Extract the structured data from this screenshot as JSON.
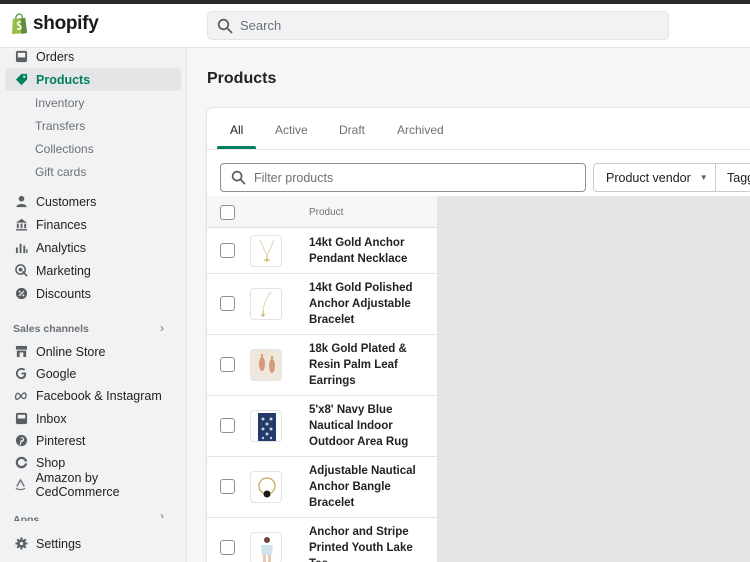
{
  "app": {
    "logo_text": "shopify"
  },
  "search": {
    "placeholder": "Search"
  },
  "sidebar": {
    "items": [
      {
        "label": "Orders",
        "icon": "inbox-icon"
      },
      {
        "label": "Products",
        "icon": "tag-icon",
        "active": true
      },
      {
        "label": "Customers",
        "icon": "person-icon"
      },
      {
        "label": "Finances",
        "icon": "bank-icon"
      },
      {
        "label": "Analytics",
        "icon": "bar-chart-icon"
      },
      {
        "label": "Marketing",
        "icon": "target-icon"
      },
      {
        "label": "Discounts",
        "icon": "discount-icon"
      }
    ],
    "product_subitems": [
      "Inventory",
      "Transfers",
      "Collections",
      "Gift cards"
    ],
    "sales_channels_label": "Sales channels",
    "channels": [
      {
        "label": "Online Store",
        "icon": "store-icon"
      },
      {
        "label": "Google",
        "icon": "google-icon"
      },
      {
        "label": "Facebook & Instagram",
        "icon": "meta-icon"
      },
      {
        "label": "Inbox",
        "icon": "inbox-icon"
      },
      {
        "label": "Pinterest",
        "icon": "pinterest-icon"
      },
      {
        "label": "Shop",
        "icon": "shop-icon"
      },
      {
        "label": "Amazon by CedCommerce",
        "icon": "amazon-icon"
      }
    ],
    "apps_label": "Apps",
    "settings_label": "Settings"
  },
  "main": {
    "title": "Products",
    "tabs": [
      "All",
      "Active",
      "Draft",
      "Archived"
    ],
    "active_tab": "All",
    "filter_placeholder": "Filter products",
    "vendor_button": "Product vendor",
    "tagged_button": "Tagg",
    "table": {
      "column_product": "Product",
      "rows": [
        {
          "name": "14kt Gold Anchor Pendant Necklace"
        },
        {
          "name": "14kt Gold Polished Anchor Adjustable Bracelet"
        },
        {
          "name": "18k Gold Plated & Resin Palm Leaf Earrings"
        },
        {
          "name": "5'x8' Navy Blue Nautical Indoor Outdoor Area Rug"
        },
        {
          "name": "Adjustable Nautical Anchor Bangle Bracelet"
        },
        {
          "name": "Anchor and Stripe Printed Youth Lake Tee"
        }
      ]
    }
  },
  "colors": {
    "accent": "#008060",
    "active_text": "#007f5f"
  }
}
